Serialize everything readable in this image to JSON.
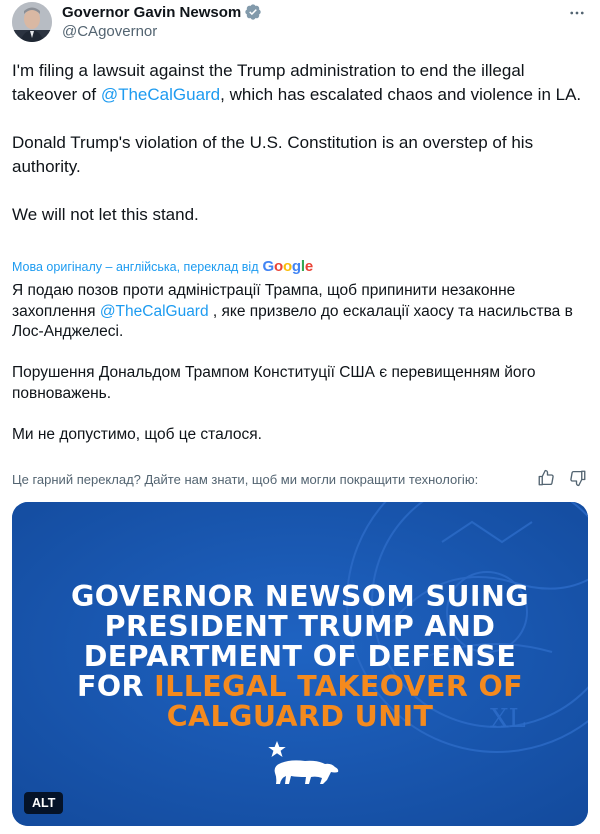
{
  "author": {
    "name": "Governor Gavin Newsom",
    "handle": "@CAgovernor",
    "verified": true,
    "avatar_icon": "avatar-photo",
    "more_icon": "more-icon"
  },
  "tweet": {
    "p1_before": "I'm filing a lawsuit against the Trump administration to end the illegal takeover of ",
    "p1_mention": "@TheCalGuard",
    "p1_after": ", which has escalated chaos and violence in LA.",
    "p2": "Donald Trump's violation of the U.S. Constitution is an overstep of his authority.",
    "p3": "We will not let this stand."
  },
  "translation_notice": {
    "label": "Мова оригіналу – англійська, переклад від",
    "brand": "Google"
  },
  "translation": {
    "p1_before": "Я подаю позов проти адміністрації Трампа, щоб припинити незаконне захоплення ",
    "p1_mention": "@TheCalGuard",
    "p1_after": " , яке призвело до ескалації хаосу та насильства в Лос-Анджелесі.",
    "p2": "Порушення Дональдом Трампом Конституції США є перевищенням його повноважень.",
    "p3": "Ми не допустимо, щоб це сталося."
  },
  "feedback": {
    "question": "Це гарний переклад? Дайте нам знати, щоб ми могли покращити технологію:",
    "icons": [
      "thumbs-up-icon",
      "thumbs-down-icon"
    ]
  },
  "media": {
    "headline_line1": "GOVERNOR NEWSOM SUING",
    "headline_line2": "PRESIDENT TRUMP AND",
    "headline_line3": "DEPARTMENT OF DEFENSE",
    "headline_line4_white": "FOR ",
    "headline_line4_orange": "ILLEGAL TAKEOVER OF",
    "headline_line5_orange": "CALGUARD UNIT",
    "alt_badge": "ALT",
    "seal_letters": "XL",
    "colors": {
      "background": "#1957b0",
      "highlight": "#f48a1e",
      "text": "#ffffff"
    }
  },
  "colors": {
    "link": "#1d9bf0",
    "secondary_text": "#536471",
    "verified_badge": "#829aab"
  }
}
